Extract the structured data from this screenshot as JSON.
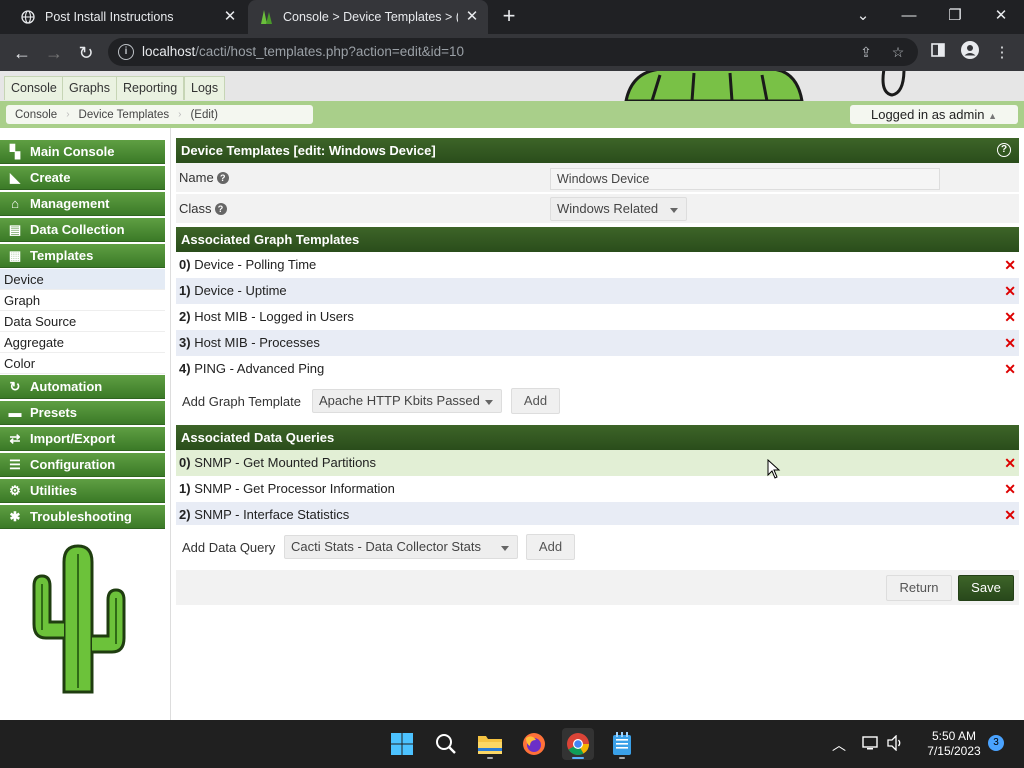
{
  "browser": {
    "tabs": [
      {
        "title": "Post Install Instructions",
        "active": false
      },
      {
        "title": "Console > Device Templates > (Edit)",
        "active": true
      }
    ],
    "url_host": "localhost",
    "url_path": "/cacti/host_templates.php?action=edit&id=10"
  },
  "cacti": {
    "top_tabs": [
      "Console",
      "Graphs",
      "Reporting",
      "Logs"
    ],
    "breadcrumbs": [
      "Console",
      "Device Templates",
      "(Edit)"
    ],
    "user_status": "Logged in as admin"
  },
  "sidebar": {
    "menu": [
      {
        "label": "Main Console",
        "icon": "map-icon"
      },
      {
        "label": "Create",
        "icon": "chart-icon"
      },
      {
        "label": "Management",
        "icon": "home-icon"
      },
      {
        "label": "Data Collection",
        "icon": "database-icon"
      },
      {
        "label": "Templates",
        "icon": "template-icon"
      }
    ],
    "templates_submenu": [
      "Device",
      "Graph",
      "Data Source",
      "Aggregate",
      "Color"
    ],
    "menu_after": [
      {
        "label": "Automation",
        "icon": "refresh-icon"
      },
      {
        "label": "Presets",
        "icon": "preset-icon"
      },
      {
        "label": "Import/Export",
        "icon": "transfer-icon"
      },
      {
        "label": "Configuration",
        "icon": "sliders-icon"
      },
      {
        "label": "Utilities",
        "icon": "cogs-icon"
      },
      {
        "label": "Troubleshooting",
        "icon": "bug-icon"
      }
    ]
  },
  "form": {
    "title": "Device Templates [edit: Windows Device]",
    "name_label": "Name",
    "name_value": "Windows Device",
    "class_label": "Class",
    "class_value": "Windows Related"
  },
  "graph_templates": {
    "title": "Associated Graph Templates",
    "items": [
      {
        "index": "0)",
        "name": "Device - Polling Time"
      },
      {
        "index": "1)",
        "name": "Device - Uptime"
      },
      {
        "index": "2)",
        "name": "Host MIB - Logged in Users"
      },
      {
        "index": "3)",
        "name": "Host MIB - Processes"
      },
      {
        "index": "4)",
        "name": "PING - Advanced Ping"
      }
    ],
    "add_label": "Add Graph Template",
    "add_select": "Apache HTTP Kbits Passed",
    "add_button": "Add"
  },
  "data_queries": {
    "title": "Associated Data Queries",
    "items": [
      {
        "index": "0)",
        "name": "SNMP - Get Mounted Partitions"
      },
      {
        "index": "1)",
        "name": "SNMP - Get Processor Information"
      },
      {
        "index": "2)",
        "name": "SNMP - Interface Statistics"
      }
    ],
    "add_label": "Add Data Query",
    "add_select": "Cacti Stats - Data Collector Stats",
    "add_button": "Add"
  },
  "actions": {
    "return": "Return",
    "save": "Save"
  },
  "taskbar": {
    "time": "5:50 AM",
    "date": "7/15/2023",
    "notifications": "3"
  }
}
